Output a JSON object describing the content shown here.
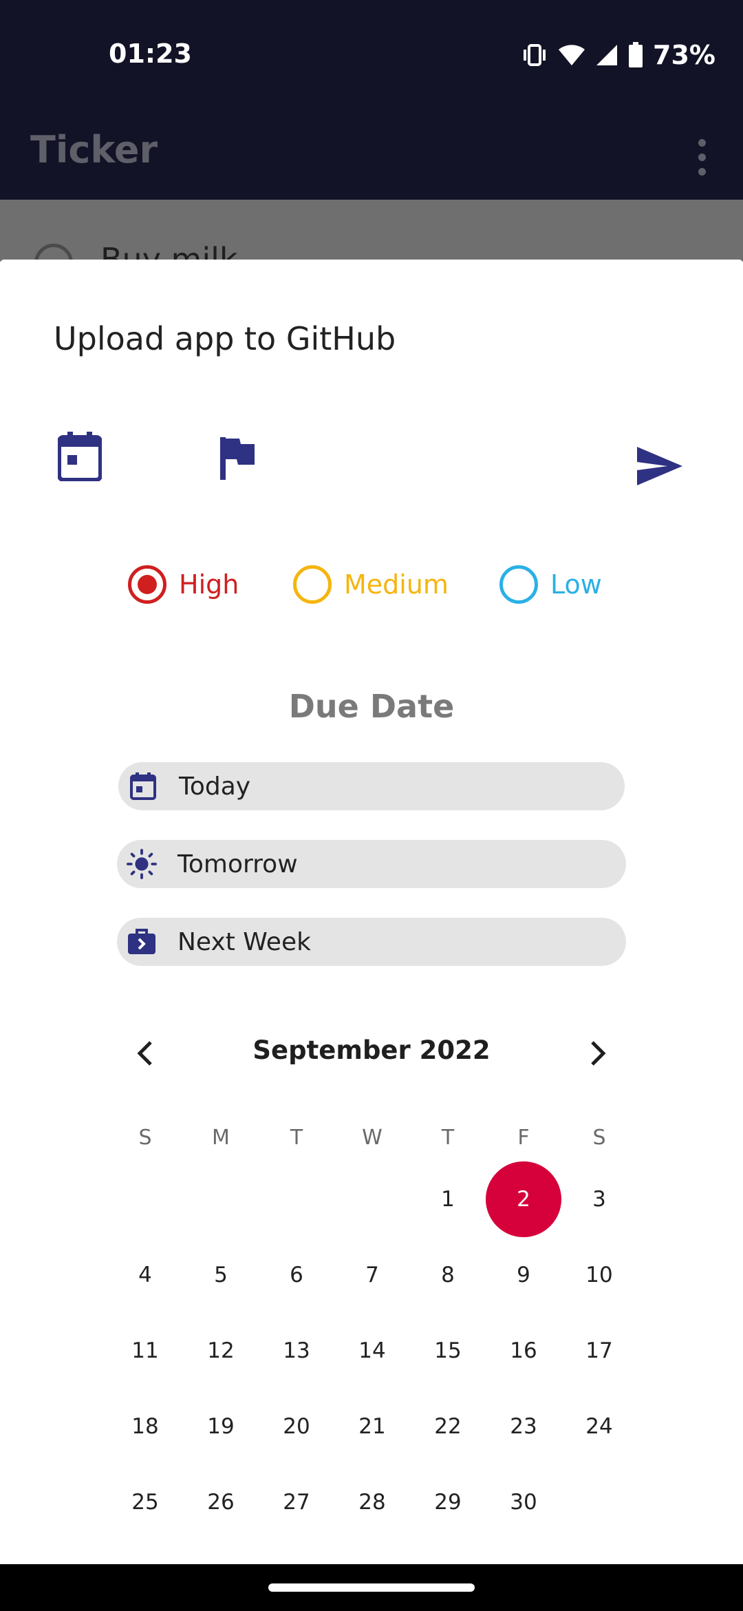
{
  "status_bar": {
    "time": "01:23",
    "battery": "73%"
  },
  "app_bar": {
    "title": "Ticker"
  },
  "background_list": {
    "visible_task": "Buy milk"
  },
  "sheet": {
    "task_title": "Upload app to GitHub",
    "priority": {
      "options": [
        {
          "label": "High",
          "color": "#d01f1f",
          "selected": true
        },
        {
          "label": "Medium",
          "color": "#f5b50e",
          "selected": false
        },
        {
          "label": "Low",
          "color": "#2ab0e6",
          "selected": false
        }
      ]
    },
    "due_date": {
      "heading": "Due Date",
      "quick_options": [
        {
          "label": "Today",
          "icon": "calendar-icon"
        },
        {
          "label": "Tomorrow",
          "icon": "sun-icon"
        },
        {
          "label": "Next Week",
          "icon": "next-week-briefcase-icon"
        }
      ]
    },
    "calendar": {
      "month_label": "September 2022",
      "weekday_headers": [
        "S",
        "M",
        "T",
        "W",
        "T",
        "F",
        "S"
      ],
      "weeks": [
        [
          "",
          "",
          "",
          "",
          "1",
          "2",
          "3"
        ],
        [
          "4",
          "5",
          "6",
          "7",
          "8",
          "9",
          "10"
        ],
        [
          "11",
          "12",
          "13",
          "14",
          "15",
          "16",
          "17"
        ],
        [
          "18",
          "19",
          "20",
          "21",
          "22",
          "23",
          "24"
        ],
        [
          "25",
          "26",
          "27",
          "28",
          "29",
          "30",
          ""
        ]
      ],
      "selected_day": "2",
      "selected_color": "#d6003b"
    }
  },
  "colors": {
    "accent": "#2f3182",
    "status_bar_bg": "#131327"
  }
}
